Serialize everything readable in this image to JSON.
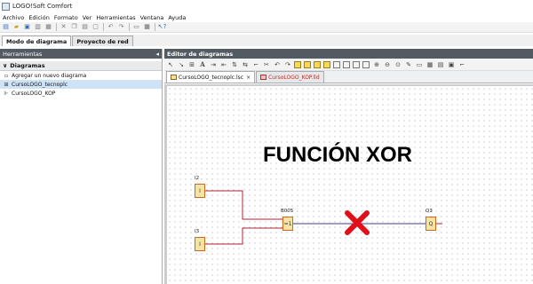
{
  "app": {
    "title": "LOGO!Soft Comfort"
  },
  "menu": [
    "Archivo",
    "Edición",
    "Formato",
    "Ver",
    "Herramientas",
    "Ventana",
    "Ayuda"
  ],
  "mode_tabs": {
    "diagram": "Modo de diagrama",
    "network": "Proyecto de red"
  },
  "tools_panel": {
    "header": "Herramientas",
    "section": "Diagramas",
    "items": [
      "Agregar un nuevo diagrama",
      "CursoLOGO_tecnoplc",
      "CursoLOGO_KOP"
    ]
  },
  "editor": {
    "header": "Editor de diagramas",
    "tabs": [
      "CursoLOGO_tecnoplc.lsc",
      "CursoLOGO_KOP.lld"
    ]
  },
  "diagram": {
    "title": "FUNCIÓN XOR",
    "blocks": {
      "input1": {
        "label": "I2",
        "symbol": "I"
      },
      "input2": {
        "label": "I3",
        "symbol": "I"
      },
      "gate": {
        "label": "B005",
        "symbol": "=1"
      },
      "output": {
        "label": "Q3",
        "symbol": "Q"
      }
    },
    "colors": {
      "wire": "#b22234",
      "cross": "#e0101a",
      "block_fill": "#f7e4a4",
      "block_border": "#c86a20"
    }
  }
}
